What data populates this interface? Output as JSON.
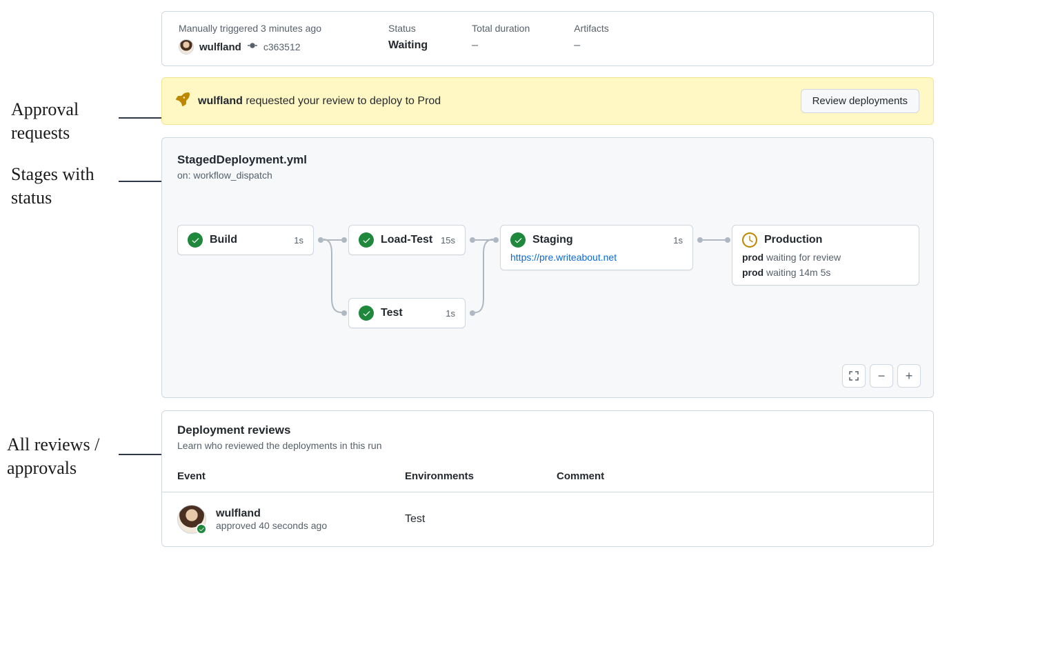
{
  "annotations": {
    "approval": "Approval\nrequests",
    "stages": "Stages with\nstatus",
    "reviews": "All reviews /\napprovals"
  },
  "summary": {
    "trigger_label": "Manually triggered 3 minutes ago",
    "username": "wulfland",
    "commit": "c363512",
    "status_label": "Status",
    "status_value": "Waiting",
    "duration_label": "Total duration",
    "duration_value": "–",
    "artifacts_label": "Artifacts",
    "artifacts_value": "–"
  },
  "approval": {
    "requester": "wulfland",
    "text_suffix": "requested your review to deploy to",
    "env": "Prod",
    "button": "Review deployments"
  },
  "workflow": {
    "title": "StagedDeployment.yml",
    "subtitle": "on: workflow_dispatch",
    "stages": {
      "build": {
        "name": "Build",
        "time": "1s"
      },
      "loadtest": {
        "name": "Load-Test",
        "time": "15s"
      },
      "test": {
        "name": "Test",
        "time": "1s"
      },
      "staging": {
        "name": "Staging",
        "time": "1s",
        "url": "https://pre.writeabout.net"
      },
      "production": {
        "name": "Production",
        "detail1_prefix": "prod",
        "detail1_text": "waiting for review",
        "detail2_prefix": "prod",
        "detail2_text": "waiting 14m 5s"
      }
    }
  },
  "reviews": {
    "title": "Deployment reviews",
    "subtitle": "Learn who reviewed the deployments in this run",
    "columns": {
      "event": "Event",
      "env": "Environments",
      "comment": "Comment"
    },
    "row": {
      "user": "wulfland",
      "action": "approved 40 seconds ago",
      "env": "Test"
    }
  }
}
